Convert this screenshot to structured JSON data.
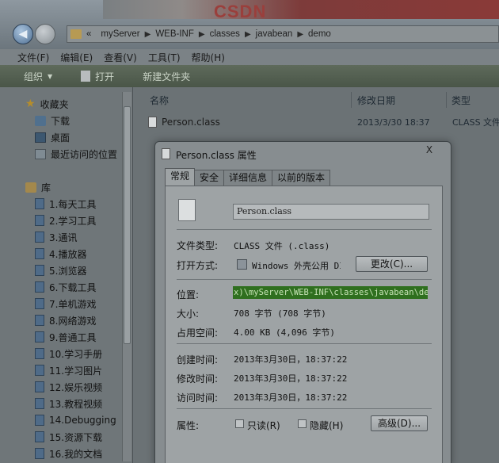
{
  "address": {
    "prefix": "«",
    "crumbs": [
      "myServer",
      "WEB-INF",
      "classes",
      "javabean",
      "demo"
    ]
  },
  "menu": [
    "文件(F)",
    "编辑(E)",
    "查看(V)",
    "工具(T)",
    "帮助(H)"
  ],
  "toolbar": {
    "organize": "组织",
    "open": "打开",
    "new_folder": "新建文件夹"
  },
  "nav": {
    "favorites": "收藏夹",
    "fav_items": [
      "下载",
      "桌面",
      "最近访问的位置"
    ],
    "library": "库",
    "lib_items": [
      "1.每天工具",
      "2.学习工具",
      "3.通讯",
      "4.播放器",
      "5.浏览器",
      "6.下载工具",
      "7.单机游戏",
      "8.网络游戏",
      "9.普通工具",
      "10.学习手册",
      "11.学习图片",
      "12.娱乐视频",
      "13.教程视频",
      "14.Debugging",
      "15.资源下载",
      "16.我的文档"
    ]
  },
  "columns": {
    "name": "名称",
    "date": "修改日期",
    "type": "类型"
  },
  "file": {
    "name": "Person.class",
    "date": "2013/3/30 18:37",
    "type": "CLASS 文件"
  },
  "dialog": {
    "title": "Person.class 属性",
    "close": "X",
    "tabs": [
      "常规",
      "安全",
      "详细信息",
      "以前的版本"
    ],
    "filename": "Person.class",
    "file_type_label": "文件类型:",
    "file_type_value": "CLASS 文件 (.class)",
    "open_with_label": "打开方式:",
    "open_with_value": "Windows 外壳公用 DI",
    "change_button": "更改(C)...",
    "location_label": "位置:",
    "location_value": "x)\\myServer\\WEB-INF\\classes\\javabean\\demo",
    "size_label": "大小:",
    "size_value": "708 字节 (708 字节)",
    "disk_label": "占用空间:",
    "disk_value": "4.00 KB (4,096 字节)",
    "created_label": "创建时间:",
    "created_value": "2013年3月30日，18:37:22",
    "modified_label": "修改时间:",
    "modified_value": "2013年3月30日，18:37:22",
    "accessed_label": "访问时间:",
    "accessed_value": "2013年3月30日，18:37:22",
    "attributes_label": "属性:",
    "readonly": "只读(R)",
    "hidden": "隐藏(H)",
    "advanced_button": "高级(D)..."
  }
}
